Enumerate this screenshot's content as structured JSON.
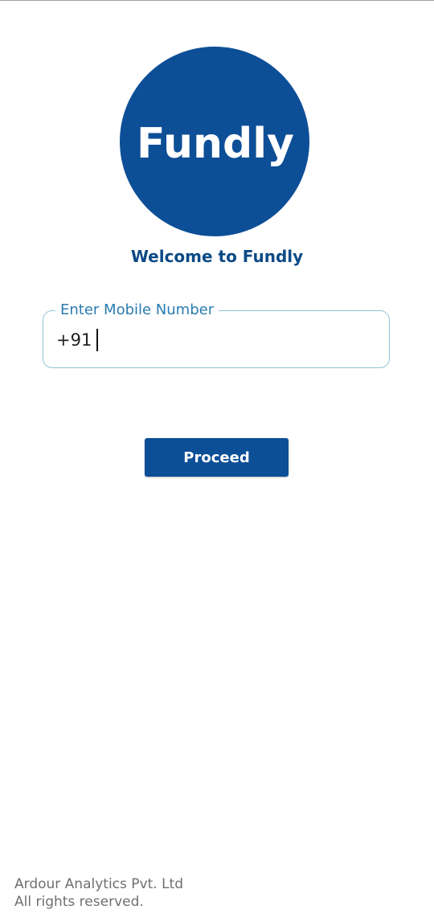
{
  "logo": {
    "text": "Fundly",
    "color": "#0d4f97"
  },
  "welcome": {
    "title": "Welcome to Fundly"
  },
  "mobile_field": {
    "label": "Enter Mobile Number",
    "value": "+91"
  },
  "actions": {
    "proceed_label": "Proceed"
  },
  "footer": {
    "company": "Ardour Analytics Pvt. Ltd",
    "rights": "All rights reserved."
  },
  "colors": {
    "brand": "#0d4f97",
    "label": "#2a7bb0",
    "field_border": "#8fc6d4",
    "footer_text": "#6f6f6f"
  }
}
